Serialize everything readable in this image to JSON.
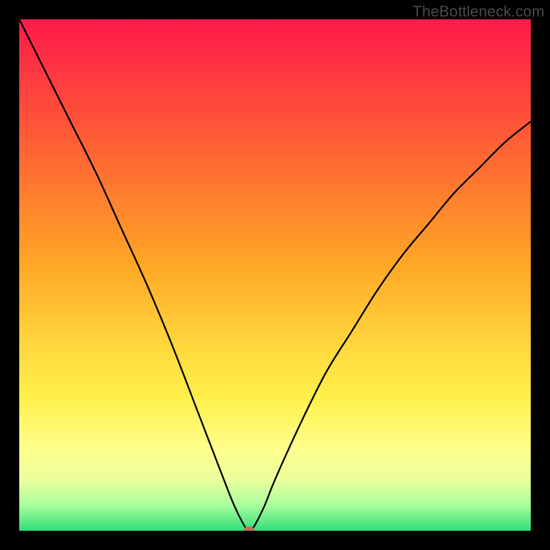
{
  "watermark": "TheBottleneck.com",
  "chart_data": {
    "type": "line",
    "title": "",
    "xlabel": "",
    "ylabel": "",
    "xlim": [
      0,
      100
    ],
    "ylim": [
      0,
      100
    ],
    "grid": false,
    "legend": false,
    "x": [
      0,
      5,
      10,
      15,
      20,
      25,
      30,
      35,
      40,
      42,
      44,
      45,
      46,
      48,
      50,
      55,
      60,
      65,
      70,
      75,
      80,
      85,
      90,
      95,
      100
    ],
    "values": [
      100,
      90,
      80,
      70,
      59,
      48,
      36,
      23,
      10,
      5,
      1,
      0,
      1,
      5,
      10,
      21,
      31,
      39,
      47,
      54,
      60,
      66,
      71,
      76,
      80
    ],
    "min_marker": {
      "x": 45,
      "y": 0
    },
    "background_gradient": {
      "direction": "vertical",
      "stops": [
        {
          "pos": 0.0,
          "color": "#ff1a4b"
        },
        {
          "pos": 0.18,
          "color": "#ff4d3a"
        },
        {
          "pos": 0.33,
          "color": "#ff7a2e"
        },
        {
          "pos": 0.48,
          "color": "#ffa726"
        },
        {
          "pos": 0.62,
          "color": "#ffd23b"
        },
        {
          "pos": 0.74,
          "color": "#fff04a"
        },
        {
          "pos": 0.84,
          "color": "#ffff8c"
        },
        {
          "pos": 0.9,
          "color": "#eaff9c"
        },
        {
          "pos": 0.95,
          "color": "#a8ff9c"
        },
        {
          "pos": 1.0,
          "color": "#2fde7a"
        }
      ]
    }
  }
}
